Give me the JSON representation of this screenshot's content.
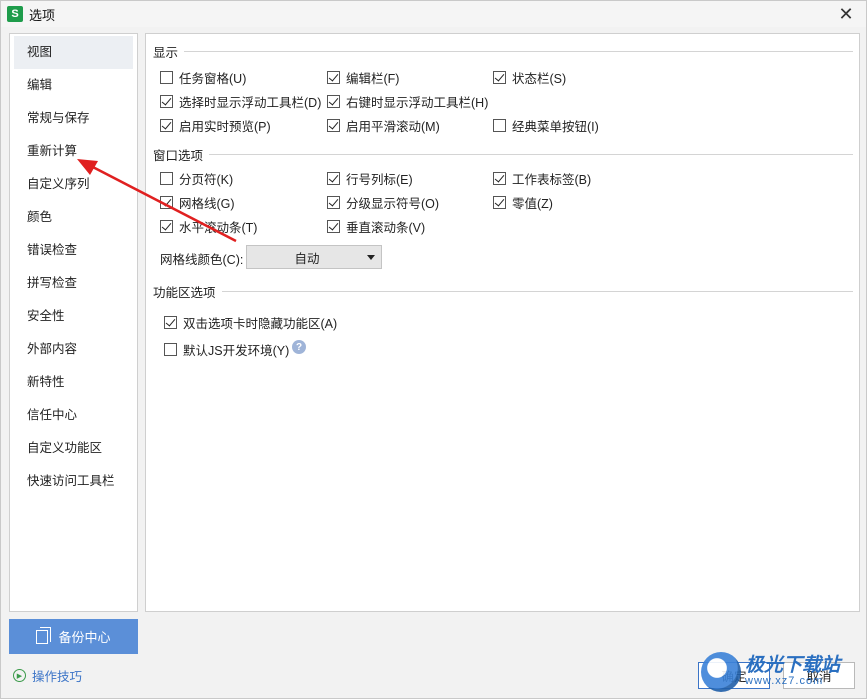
{
  "window": {
    "title": "选项",
    "app_icon_letter": "S",
    "close_glyph": "✕"
  },
  "sidebar": {
    "items": [
      {
        "label": "视图",
        "active": true
      },
      {
        "label": "编辑"
      },
      {
        "label": "常规与保存"
      },
      {
        "label": "重新计算"
      },
      {
        "label": "自定义序列"
      },
      {
        "label": "颜色"
      },
      {
        "label": "错误检查"
      },
      {
        "label": "拼写检查"
      },
      {
        "label": "安全性"
      },
      {
        "label": "外部内容"
      },
      {
        "label": "新特性"
      },
      {
        "label": "信任中心"
      },
      {
        "label": "自定义功能区"
      },
      {
        "label": "快速访问工具栏"
      }
    ],
    "backup_label": "备份中心",
    "tips_label": "操作技巧"
  },
  "display": {
    "title": "显示",
    "options": [
      {
        "label": "任务窗格(U)",
        "checked": false
      },
      {
        "label": "编辑栏(F)",
        "checked": true
      },
      {
        "label": "状态栏(S)",
        "checked": true
      },
      {
        "label": "选择时显示浮动工具栏(D)",
        "checked": true
      },
      {
        "label": "右键时显示浮动工具栏(H)",
        "checked": true
      },
      {
        "label": "启用实时预览(P)",
        "checked": true
      },
      {
        "label": "启用平滑滚动(M)",
        "checked": true
      },
      {
        "label": "经典菜单按钮(I)",
        "checked": false
      }
    ]
  },
  "window_options": {
    "title": "窗口选项",
    "options": [
      {
        "label": "分页符(K)",
        "checked": false
      },
      {
        "label": "行号列标(E)",
        "checked": true
      },
      {
        "label": "工作表标签(B)",
        "checked": true
      },
      {
        "label": "网格线(G)",
        "checked": true
      },
      {
        "label": "分级显示符号(O)",
        "checked": true
      },
      {
        "label": "零值(Z)",
        "checked": true
      },
      {
        "label": "水平滚动条(T)",
        "checked": true
      },
      {
        "label": "垂直滚动条(V)",
        "checked": true
      }
    ],
    "grid_color_label": "网格线颜色(C):",
    "grid_color_value": "自动"
  },
  "ribbon": {
    "title": "功能区选项",
    "options": [
      {
        "label": "双击选项卡时隐藏功能区(A)",
        "checked": true
      },
      {
        "label": "默认JS开发环境(Y)",
        "checked": false
      }
    ],
    "help_glyph": "?"
  },
  "buttons": {
    "ok": "确定",
    "cancel": "取消"
  },
  "watermark": {
    "main": "极光下载站",
    "sub": "www.xz7.com"
  },
  "colors": {
    "accent": "#5b8fd8",
    "arrow": "#e02020",
    "link": "#3b74c7"
  }
}
